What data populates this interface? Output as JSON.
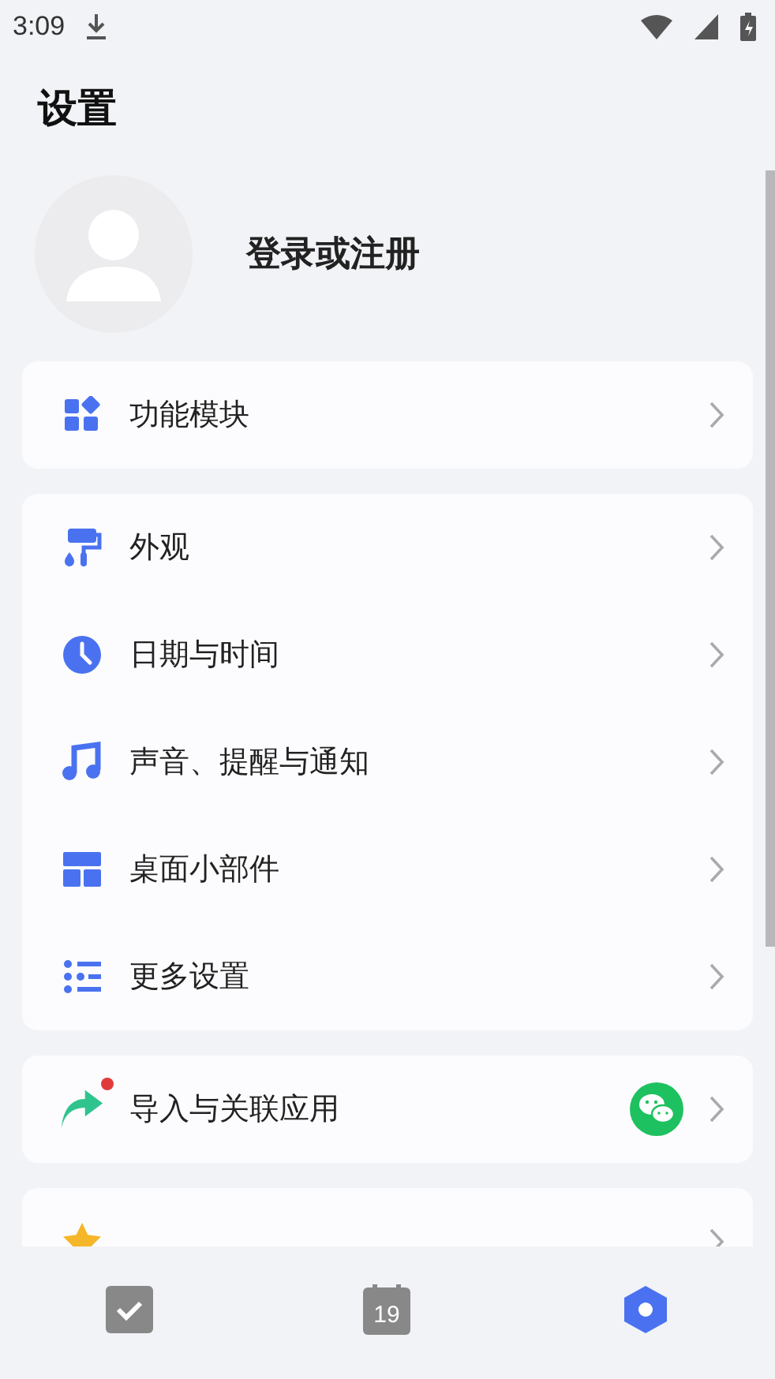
{
  "status_bar": {
    "time": "3:09"
  },
  "title": "设置",
  "account": {
    "label": "登录或注册"
  },
  "groups": [
    {
      "items": [
        {
          "kind": "modules",
          "label": "功能模块",
          "badge": false,
          "wechat": false
        }
      ]
    },
    {
      "items": [
        {
          "kind": "appearance",
          "label": "外观",
          "badge": false,
          "wechat": false
        },
        {
          "kind": "clock",
          "label": "日期与时间",
          "badge": false,
          "wechat": false
        },
        {
          "kind": "music",
          "label": "声音、提醒与通知",
          "badge": false,
          "wechat": false
        },
        {
          "kind": "widget",
          "label": "桌面小部件",
          "badge": false,
          "wechat": false
        },
        {
          "kind": "more",
          "label": "更多设置",
          "badge": false,
          "wechat": false
        }
      ]
    },
    {
      "items": [
        {
          "kind": "share",
          "label": "导入与关联应用",
          "badge": true,
          "wechat": true
        }
      ]
    },
    {
      "items": [
        {
          "kind": "star",
          "badge": false,
          "wechat": false
        }
      ]
    }
  ],
  "tabs": [
    {
      "kind": "tasks",
      "selected": false
    },
    {
      "kind": "calendar",
      "text": "19",
      "selected": false
    },
    {
      "kind": "settings",
      "selected": true
    }
  ]
}
